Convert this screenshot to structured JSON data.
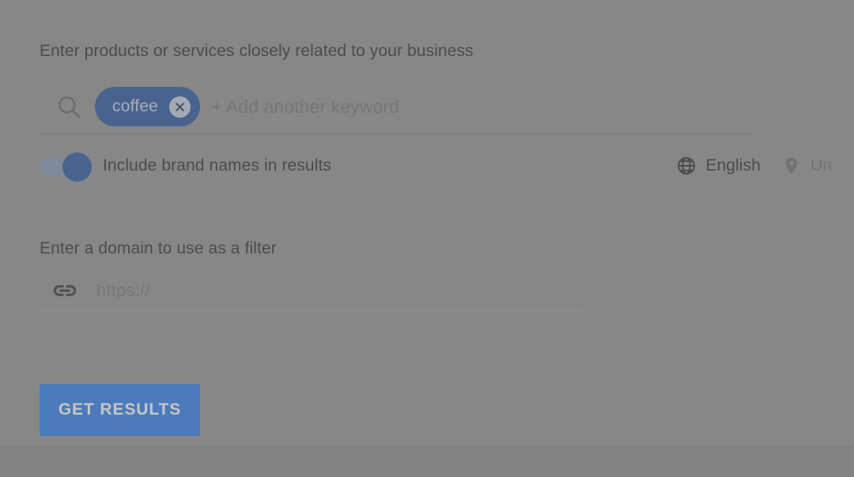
{
  "keywords_section": {
    "label": "Enter products or services closely related to your business",
    "search_icon": "search-icon",
    "chips": [
      {
        "label": "coffee",
        "remove_icon": "close-icon"
      }
    ],
    "add_placeholder": "+ Add another keyword"
  },
  "options": {
    "brand_toggle": {
      "label": "Include brand names in results",
      "state": "on"
    },
    "language": {
      "icon": "globe-icon",
      "value": "English"
    },
    "location": {
      "icon": "location-pin-icon",
      "value": "Un"
    }
  },
  "domain_section": {
    "label": "Enter a domain to use as a filter",
    "icon": "link-icon",
    "placeholder": "https://",
    "value": ""
  },
  "actions": {
    "get_results_label": "GET RESULTS"
  },
  "colors": {
    "primary_button": "#1f76ef",
    "chip_background": "#1b4a9c",
    "toggle_knob": "#1b4a9c",
    "page_background": "#8d8d8d"
  }
}
